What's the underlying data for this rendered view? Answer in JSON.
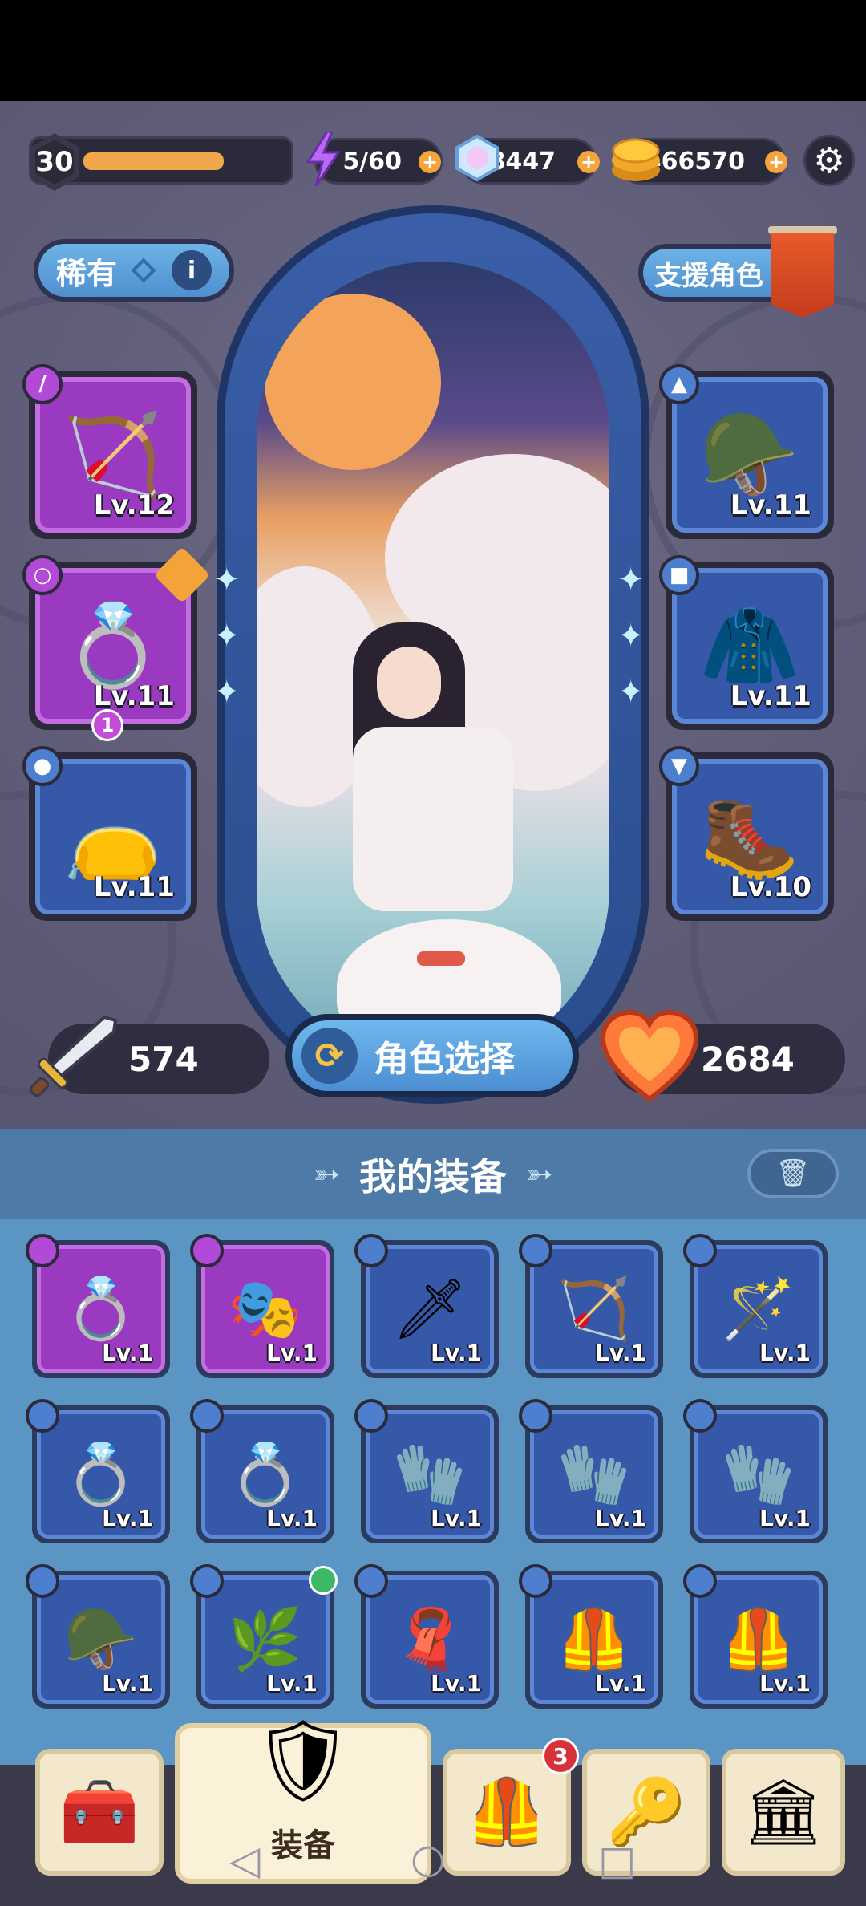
{
  "hud": {
    "level": "30",
    "level_progress": 0.7,
    "energy": "5/60",
    "gems": "8447",
    "coins": "466570",
    "plus": "+"
  },
  "rarity": {
    "label": "稀有",
    "info": "i"
  },
  "support": {
    "label": "支援角色"
  },
  "equipped_left": [
    {
      "level": "Lv.12",
      "rarity": "purple",
      "type_icon": "sword-icon",
      "art": "bow-icon"
    },
    {
      "level": "Lv.11",
      "rarity": "purple",
      "type_icon": "ring-icon",
      "art": "ring-icon",
      "count": "1"
    },
    {
      "level": "Lv.11",
      "rarity": "blue",
      "type_icon": "amulet-icon",
      "art": "pouch-icon"
    }
  ],
  "equipped_right": [
    {
      "level": "Lv.11",
      "rarity": "blue",
      "type_icon": "helmet-icon",
      "art": "hood-icon"
    },
    {
      "level": "Lv.11",
      "rarity": "blue",
      "type_icon": "armor-icon",
      "art": "cloak-icon"
    },
    {
      "level": "Lv.10",
      "rarity": "blue",
      "type_icon": "boots-icon",
      "art": "boots-icon"
    }
  ],
  "stats": {
    "attack": "574",
    "hp": "2684"
  },
  "char_select": {
    "label": "角色选择"
  },
  "inventory": {
    "title": "我的装备",
    "items": [
      {
        "level": "Lv.1",
        "rarity": "purple",
        "art": "ring-icon"
      },
      {
        "level": "Lv.1",
        "rarity": "purple",
        "art": "mask-icon"
      },
      {
        "level": "Lv.1",
        "rarity": "blue",
        "art": "dagger-icon"
      },
      {
        "level": "Lv.1",
        "rarity": "blue",
        "art": "bow-icon"
      },
      {
        "level": "Lv.1",
        "rarity": "blue",
        "art": "staff-icon"
      },
      {
        "level": "Lv.1",
        "rarity": "blue",
        "art": "ring-icon"
      },
      {
        "level": "Lv.1",
        "rarity": "blue",
        "art": "ring-icon"
      },
      {
        "level": "Lv.1",
        "rarity": "blue",
        "art": "gauntlet-icon"
      },
      {
        "level": "Lv.1",
        "rarity": "blue",
        "art": "gauntlet-icon"
      },
      {
        "level": "Lv.1",
        "rarity": "blue",
        "art": "gauntlet-icon"
      },
      {
        "level": "Lv.1",
        "rarity": "blue",
        "art": "hood-icon"
      },
      {
        "level": "Lv.1",
        "rarity": "blue",
        "art": "leaf-helm-icon"
      },
      {
        "level": "Lv.1",
        "rarity": "blue",
        "art": "scarf-icon"
      },
      {
        "level": "Lv.1",
        "rarity": "blue",
        "art": "armor-icon"
      },
      {
        "level": "Lv.1",
        "rarity": "blue",
        "art": "armor-icon"
      }
    ]
  },
  "nav": {
    "active_label": "装备",
    "badge": "3"
  },
  "colors": {
    "accent_blue": "#5c86d6",
    "accent_purple": "#c36ee0",
    "gold": "#f3a43a"
  }
}
